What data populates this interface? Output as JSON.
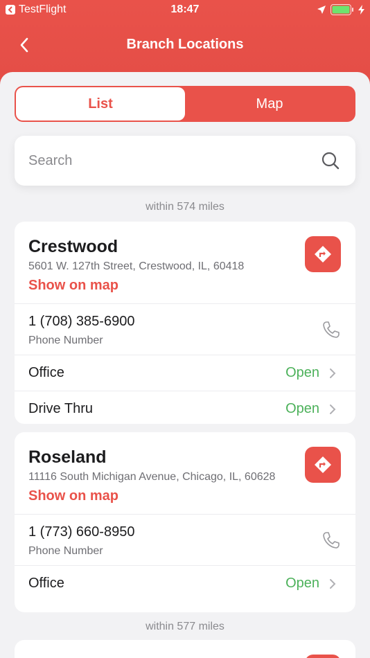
{
  "status_bar": {
    "app": "TestFlight",
    "time": "18:47"
  },
  "nav": {
    "title": "Branch Locations"
  },
  "tabs": [
    {
      "label": "List",
      "active": true
    },
    {
      "label": "Map",
      "active": false
    }
  ],
  "search": {
    "placeholder": "Search",
    "value": ""
  },
  "groups": [
    {
      "distance": "within 574 miles"
    },
    {
      "distance": "within 577 miles"
    }
  ],
  "branches": [
    {
      "name": "Crestwood",
      "address": "5601 W. 127th Street, Crestwood, IL, 60418",
      "show_map": "Show on map",
      "phone": "1 (708) 385-6900",
      "phone_label": "Phone Number",
      "hours": [
        {
          "label": "Office",
          "status": "Open"
        },
        {
          "label": "Drive Thru",
          "status": "Open"
        }
      ]
    },
    {
      "name": "Roseland",
      "address": "11116 South Michigan Avenue, Chicago, IL, 60628",
      "show_map": "Show on map",
      "phone": "1 (773) 660-8950",
      "phone_label": "Phone Number",
      "hours": [
        {
          "label": "Office",
          "status": "Open"
        }
      ]
    }
  ],
  "colors": {
    "brand": "#e9524a",
    "open": "#4cb15a",
    "background": "#f2f2f4"
  }
}
